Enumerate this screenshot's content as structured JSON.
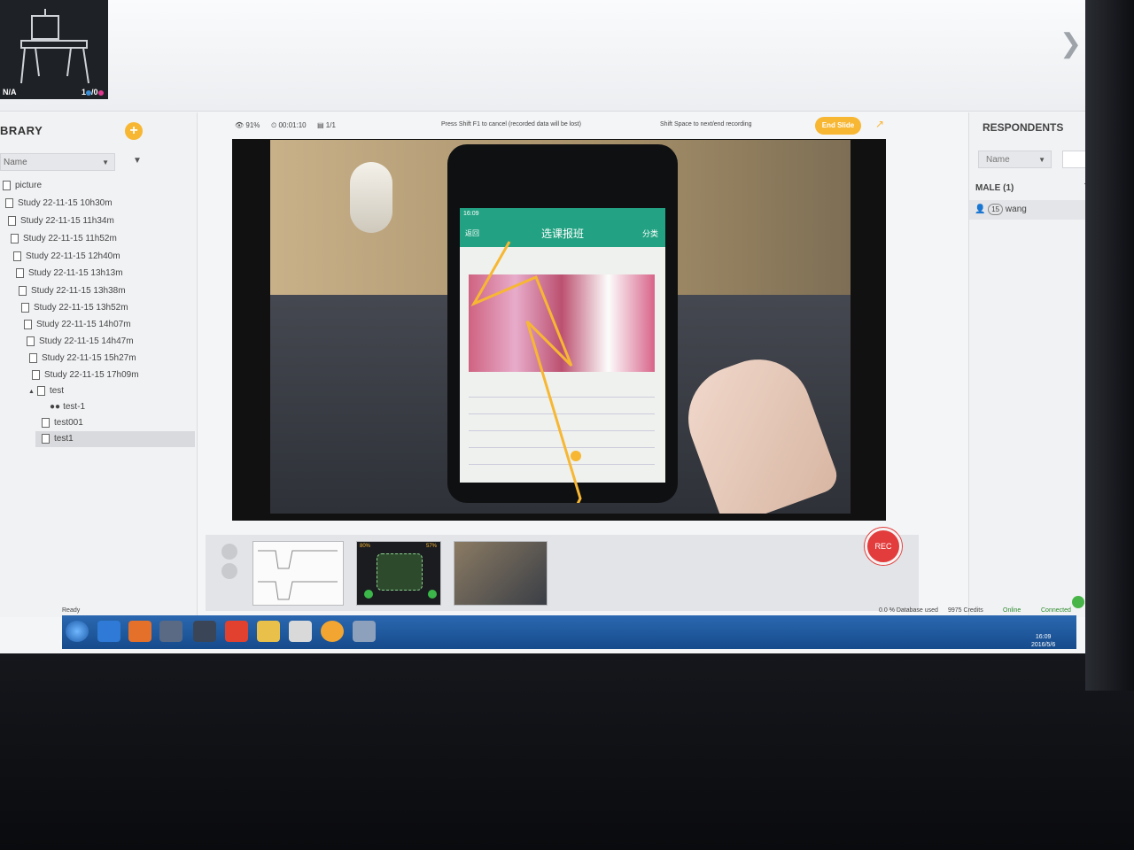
{
  "recording_thumb": {
    "status": "N/A",
    "count_a": "1",
    "count_b": "0"
  },
  "library": {
    "title": "BRARY",
    "add_label": "+",
    "sort_label": "Name",
    "items": [
      {
        "label": "picture",
        "kind": "folder"
      },
      {
        "label": "Study 22-11-15 10h30m",
        "kind": "study"
      },
      {
        "label": "Study 22-11-15 11h34m",
        "kind": "study"
      },
      {
        "label": "Study 22-11-15 11h52m",
        "kind": "study"
      },
      {
        "label": "Study 22-11-15 12h40m",
        "kind": "study"
      },
      {
        "label": "Study 22-11-15 13h13m",
        "kind": "study"
      },
      {
        "label": "Study 22-11-15 13h38m",
        "kind": "study"
      },
      {
        "label": "Study 22-11-15 13h52m",
        "kind": "study"
      },
      {
        "label": "Study 22-11-15 14h07m",
        "kind": "study"
      },
      {
        "label": "Study 22-11-15 14h47m",
        "kind": "study"
      },
      {
        "label": "Study 22-11-15 15h27m",
        "kind": "study"
      },
      {
        "label": "Study 22-11-15 17h09m",
        "kind": "study"
      },
      {
        "label": "test",
        "kind": "folder"
      },
      {
        "label": "test-1",
        "kind": "respondents"
      },
      {
        "label": "test001",
        "kind": "study"
      },
      {
        "label": "test1",
        "kind": "study",
        "selected": true
      }
    ]
  },
  "toolbar": {
    "visibility": "91%",
    "timer": "00:01:10",
    "slides": "1/1",
    "cancel_hint": "Press Shift F1 to cancel (recorded data will be lost)",
    "next_hint": "Shift Space to next/end recording",
    "end_slide_label": "End Slide"
  },
  "phone_app": {
    "status_time": "16:09",
    "header_title": "选课报班",
    "header_right": "分类",
    "back_label": "返回"
  },
  "respondents": {
    "title": "RESPONDENTS",
    "sort_label": "Name",
    "group_label": "MALE (1)",
    "users": [
      {
        "age": "15",
        "name": "wang"
      }
    ]
  },
  "recorder": {
    "rec_label": "REC",
    "frame2_left": "80%",
    "frame2_right": "57%"
  },
  "status_bar": {
    "ready": "Ready",
    "db_value": "0.0",
    "db_label": "% Database used",
    "credits_value": "9975",
    "credits_label": "Credits",
    "online_label": "Online",
    "connected_label": "Connected"
  },
  "taskbar": {
    "time": "16:09",
    "date": "2016/5/6"
  },
  "colors": {
    "accent": "#f7b733",
    "rec": "#e33c3c",
    "taskbar": "#1f5aa0",
    "app_green": "#22a282"
  }
}
